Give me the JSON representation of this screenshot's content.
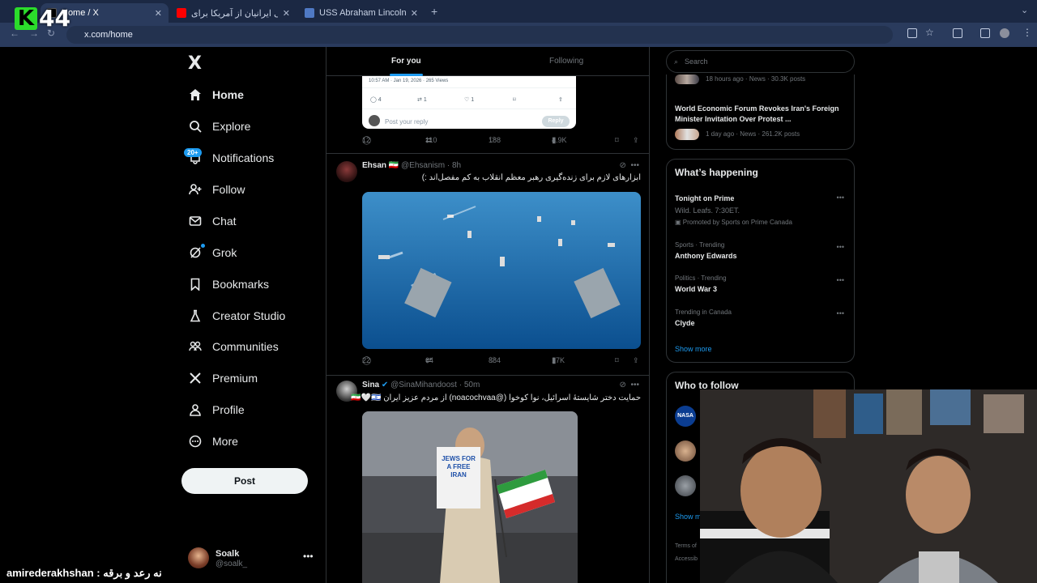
{
  "browser": {
    "tabs": [
      {
        "title": "Home / X",
        "color": "#1d9bf0"
      },
      {
        "title": "مطالبه ملی ایرانیان از آمریکا برای ...",
        "color": "#ff0000"
      },
      {
        "title": "USS Abraham Lincoln (CVN-...",
        "color": "#4f79c4"
      }
    ],
    "url": "x.com/home",
    "new_tab": "+"
  },
  "overlay": {
    "logo_letter": "K",
    "logo_number": "44",
    "caption": "amirederakhshan : نه رعد و برقه"
  },
  "sidebar": {
    "logo": "X",
    "items": [
      {
        "label": "Home",
        "icon": "home-icon"
      },
      {
        "label": "Explore",
        "icon": "search-icon"
      },
      {
        "label": "Notifications",
        "icon": "bell-icon"
      },
      {
        "label": "Follow",
        "icon": "person-add-icon"
      },
      {
        "label": "Chat",
        "icon": "mail-icon"
      },
      {
        "label": "Grok",
        "icon": "grok-icon"
      },
      {
        "label": "Bookmarks",
        "icon": "bookmark-icon"
      },
      {
        "label": "Creator Studio",
        "icon": "flask-icon"
      },
      {
        "label": "Communities",
        "icon": "people-icon"
      },
      {
        "label": "Premium",
        "icon": "x-icon"
      },
      {
        "label": "Profile",
        "icon": "person-icon"
      },
      {
        "label": "More",
        "icon": "more-circle-icon"
      }
    ],
    "notif_badge": "20+",
    "post_label": "Post",
    "account": {
      "name": "Soalk",
      "handle": "@soalk_"
    }
  },
  "timeline": {
    "tabs": {
      "for_you": "For you",
      "following": "Following"
    },
    "quote": {
      "meta": "10:57 AM · Jan 19, 2026 · 265 Views",
      "reply_placeholder": "Post your reply",
      "reply_button": "Reply",
      "counts": [
        "4",
        "1",
        "1"
      ]
    },
    "tweets": [
      {
        "replies": "12",
        "reposts": "110",
        "likes": "188",
        "views": "4.9K"
      },
      {
        "name": "Ehsan",
        "flag": "🇮🇷",
        "handle": "@Ehsanism",
        "time": "8h",
        "text": "ابزارهای لازم برای زنده‌گیری رهبر معظم انقلاب به کم مفصل‌اند :)",
        "replies": "22",
        "reposts": "64",
        "likes": "884",
        "views": "17K"
      },
      {
        "name": "Sina",
        "handle": "@SinaMihandoost",
        "time": "50m",
        "text": "حمایت دختر شایستهٔ اسرائیل، نوا کوخوا (@noacochvaa) از مردم عزیز ایران 🇮🇷🤍🇮🇱",
        "sign": "JEWS FOR A FREE IRAN"
      }
    ]
  },
  "right": {
    "search_placeholder": "Search",
    "news": [
      {
        "meta": "18 hours ago · News · 30.3K posts"
      },
      {
        "title": "World Economic Forum Revokes Iran's Foreign Minister Invitation Over Protest ...",
        "meta": "1 day ago · News · 261.2K posts"
      }
    ],
    "happening_title": "What’s happening",
    "trends": [
      {
        "title": "Tonight on Prime",
        "sub": "Wild. Leafs. 7:30ET.",
        "promo": "Promoted by Sports on Prime Canada"
      },
      {
        "context": "Sports · Trending",
        "title": "Anthony Edwards"
      },
      {
        "context": "Politics · Trending",
        "title": "World War 3"
      },
      {
        "context": "Trending in Canada",
        "title": "Clyde"
      }
    ],
    "show_more": "Show more",
    "who_to_follow": "Who to follow",
    "show_more_2": "Show m",
    "footer": [
      "Terms of",
      "Accessib"
    ],
    "nasa": "NASA"
  },
  "colors": {
    "accent": "#1d9bf0",
    "border": "#2f3336",
    "muted": "#71767b",
    "text": "#e7e9ea"
  }
}
